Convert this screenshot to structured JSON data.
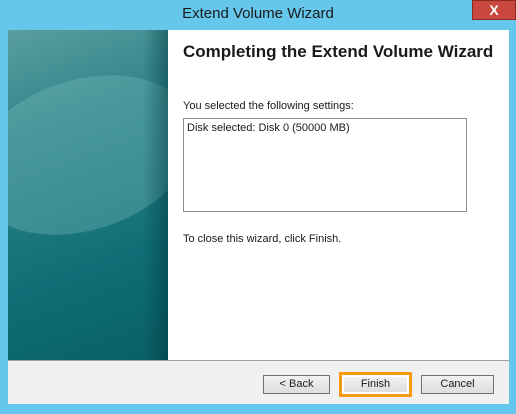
{
  "window": {
    "title": "Extend Volume Wizard",
    "close_label": "X",
    "accent_color": "#66c7ec"
  },
  "content": {
    "heading": "Completing the Extend Volume Wizard",
    "settings_label": "You selected the following settings:",
    "settings": [
      "Disk selected: Disk 0 (50000 MB)"
    ],
    "close_instruction": "To close this wizard, click Finish."
  },
  "buttons": {
    "back": "< Back",
    "finish": "Finish",
    "cancel": "Cancel",
    "highlight_color": "#f59a12"
  }
}
